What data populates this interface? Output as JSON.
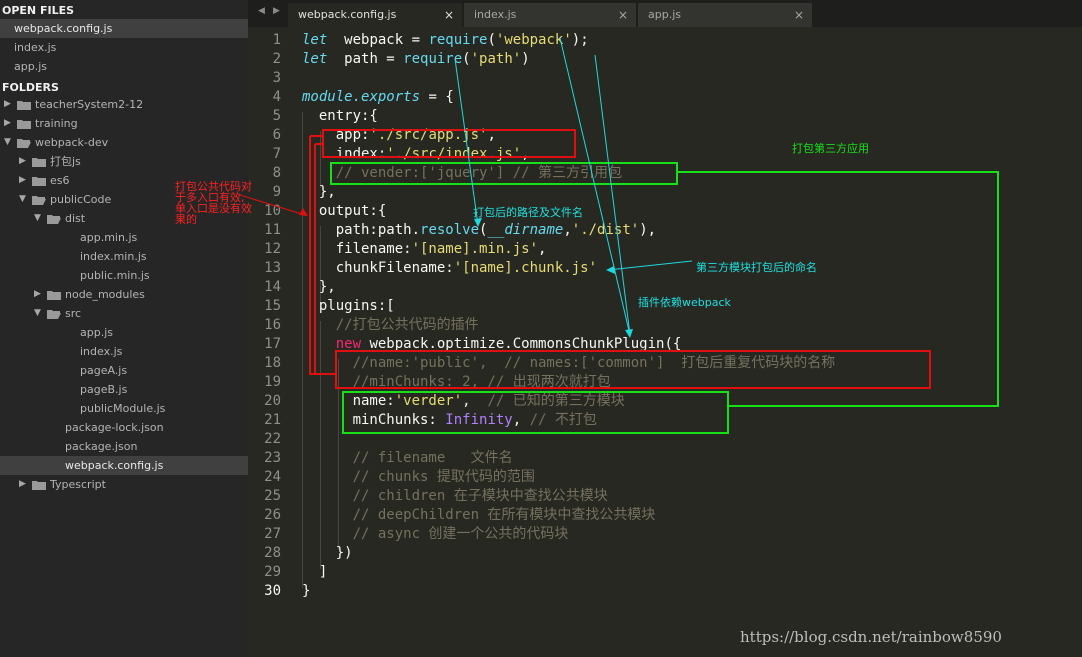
{
  "sidebar": {
    "open_files_label": "OPEN FILES",
    "open_files": [
      "webpack.config.js",
      "index.js",
      "app.js"
    ],
    "folders_label": "FOLDERS",
    "tree": [
      {
        "label": "teacherSystem2-12"
      },
      {
        "label": "training"
      },
      {
        "label": "webpack-dev"
      },
      {
        "label": "打包js"
      },
      {
        "label": "es6"
      },
      {
        "label": "publicCode"
      },
      {
        "label": "dist"
      },
      {
        "label": "app.min.js"
      },
      {
        "label": "index.min.js"
      },
      {
        "label": "public.min.js"
      },
      {
        "label": "node_modules"
      },
      {
        "label": "src"
      },
      {
        "label": "app.js"
      },
      {
        "label": "index.js"
      },
      {
        "label": "pageA.js"
      },
      {
        "label": "pageB.js"
      },
      {
        "label": "publicModule.js"
      },
      {
        "label": "package-lock.json"
      },
      {
        "label": "package.json"
      },
      {
        "label": "webpack.config.js"
      },
      {
        "label": "Typescript"
      }
    ]
  },
  "tabs": [
    {
      "label": "webpack.config.js",
      "close": "×"
    },
    {
      "label": "index.js",
      "close": "×"
    },
    {
      "label": "app.js",
      "close": "×"
    }
  ],
  "tab_nav": {
    "prev": "◀",
    "next": "▶"
  },
  "editor": {
    "line_numbers": [
      "1",
      "2",
      "3",
      "4",
      "5",
      "6",
      "7",
      "8",
      "9",
      "10",
      "11",
      "12",
      "13",
      "14",
      "15",
      "16",
      "17",
      "18",
      "19",
      "20",
      "21",
      "22",
      "23",
      "24",
      "25",
      "26",
      "27",
      "28",
      "29",
      "30"
    ],
    "current_line": "30",
    "lines": [
      [
        [
          "kw",
          "let"
        ],
        [
          "",
          "  webpack = "
        ],
        [
          "fn",
          "require"
        ],
        [
          "",
          "("
        ],
        [
          "str",
          "'webpack'"
        ],
        [
          "",
          ");"
        ]
      ],
      [
        [
          "kw",
          "let"
        ],
        [
          "",
          "  path = "
        ],
        [
          "fn",
          "require"
        ],
        [
          "",
          "("
        ],
        [
          "str",
          "'path'"
        ],
        [
          "",
          ")"
        ]
      ],
      [],
      [
        [
          "it",
          "module"
        ],
        [
          "it",
          "."
        ],
        [
          "it",
          "exports"
        ],
        [
          "",
          " = {"
        ]
      ],
      [
        [
          "",
          "  entry:{"
        ]
      ],
      [
        [
          "",
          "    app:"
        ],
        [
          "str",
          "'./src/app.js'"
        ],
        [
          "",
          ","
        ]
      ],
      [
        [
          "",
          "    index:"
        ],
        [
          "str",
          "'./src/index.js'"
        ],
        [
          "",
          ","
        ]
      ],
      [
        [
          "cm",
          "    // vender:['jquery'] // 第三方引用包"
        ]
      ],
      [
        [
          "",
          "  },"
        ]
      ],
      [
        [
          "",
          "  output:{"
        ]
      ],
      [
        [
          "",
          "    path:path."
        ],
        [
          "fn",
          "resolve"
        ],
        [
          "",
          "("
        ],
        [
          "it",
          "__dirname"
        ],
        [
          "",
          ","
        ],
        [
          "str",
          "'./dist'"
        ],
        [
          "",
          "),"
        ]
      ],
      [
        [
          "",
          "    filename:"
        ],
        [
          "str",
          "'[name].min.js'"
        ],
        [
          "",
          ","
        ]
      ],
      [
        [
          "",
          "    chunkFilename:"
        ],
        [
          "str",
          "'[name].chunk.js'"
        ]
      ],
      [
        [
          "",
          "  },"
        ]
      ],
      [
        [
          "",
          "  plugins:["
        ]
      ],
      [
        [
          "cm",
          "    //打包公共代码的插件"
        ]
      ],
      [
        [
          "nw",
          "    new"
        ],
        [
          "",
          " webpack.optimize.CommonsChunkPlugin({"
        ]
      ],
      [
        [
          "cm",
          "      //name:'public',  // names:['common']  打包后重复代码块的名称"
        ]
      ],
      [
        [
          "cm",
          "      //minChunks: 2, // 出现两次就打包"
        ]
      ],
      [
        [
          "",
          "      name:"
        ],
        [
          "str",
          "'verder'"
        ],
        [
          "",
          ",  "
        ],
        [
          "cm",
          "// 已知的第三方模块"
        ]
      ],
      [
        [
          "",
          "      minChunks: "
        ],
        [
          "num",
          "Infinity"
        ],
        [
          "",
          ", "
        ],
        [
          "cm",
          "// 不打包"
        ]
      ],
      [],
      [
        [
          "cm",
          "      // filename   文件名"
        ]
      ],
      [
        [
          "cm",
          "      // chunks 提取代码的范围"
        ]
      ],
      [
        [
          "cm",
          "      // children 在子模块中查找公共模块"
        ]
      ],
      [
        [
          "cm",
          "      // deepChildren 在所有模块中查找公共模块"
        ]
      ],
      [
        [
          "cm",
          "      // async 创建一个公共的代码块"
        ]
      ],
      [
        [
          "",
          "    })"
        ]
      ],
      [
        [
          "",
          "  ]"
        ]
      ],
      [
        [
          "",
          "}"
        ]
      ]
    ]
  },
  "annotations": {
    "red_note": "打包公共代码对\n于多入口有效,\n单入口是没有效\n果的",
    "output_path": "打包后的路径及文件名",
    "third_party_app": "打包第三方应用",
    "chunk_name": "第三方模块打包后的命名",
    "plugin_dep": "插件依赖webpack"
  },
  "colors": {
    "annot_red": "#ff2020",
    "annot_green": "#18e018",
    "annot_cyan": "#20e0e0"
  },
  "watermark": "https://blog.csdn.net/rainbow8590"
}
